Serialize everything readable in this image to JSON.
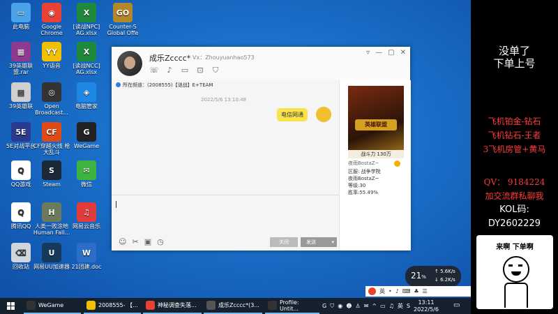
{
  "desktop": {
    "icons": [
      {
        "label": "此电脑",
        "color": "#4aa3e8",
        "glyph": "▭"
      },
      {
        "label": "Google Chrome",
        "color": "#e94235",
        "glyph": "◉"
      },
      {
        "label": "[读战NPC] AG.xlsx",
        "color": "#1f8a3c",
        "glyph": "X"
      },
      {
        "label": "Counter-S Global Offe",
        "color": "#b3872a",
        "glyph": "GO"
      },
      {
        "label": "39英雄联盟.rar",
        "color": "#8e3a8e",
        "glyph": "▦"
      },
      {
        "label": "YY语音",
        "color": "#f2c000",
        "glyph": "YY"
      },
      {
        "label": "[读战NCC] AG.xlsx",
        "color": "#1f8a3c",
        "glyph": "X"
      },
      {
        "label": "39英雄联",
        "color": "#cfcfcf",
        "glyph": "▤"
      },
      {
        "label": "Open Broadcast...",
        "color": "#333333",
        "glyph": "◎"
      },
      {
        "label": "电脑管家",
        "color": "#1e88e5",
        "glyph": "◈"
      },
      {
        "label": "5E对战平台",
        "color": "#2b3a8f",
        "glyph": "5E"
      },
      {
        "label": "CF穿越火线 枪大乱斗",
        "color": "#e04a16",
        "glyph": "CF"
      },
      {
        "label": "WeGame",
        "color": "#222222",
        "glyph": "G"
      },
      {
        "label": "QQ游戏",
        "color": "#ffffff",
        "glyph": "Q"
      },
      {
        "label": "Steam",
        "color": "#1b2838",
        "glyph": "S"
      },
      {
        "label": "微信",
        "color": "#3fb33f",
        "glyph": "✉"
      },
      {
        "label": "腾讯QQ",
        "color": "#ffffff",
        "glyph": "Q"
      },
      {
        "label": "人类一败涂地 Human Fall...",
        "color": "#6b7a5c",
        "glyph": "H"
      },
      {
        "label": "网易云音乐",
        "color": "#e23b3b",
        "glyph": "♫"
      },
      {
        "label": "回收站",
        "color": "#cfd6de",
        "glyph": "⌫"
      },
      {
        "label": "网易UU加速器",
        "color": "#163a5a",
        "glyph": "U"
      },
      {
        "label": "21团建.doc",
        "color": "#2b6dc7",
        "glyph": "W"
      }
    ]
  },
  "chat": {
    "name": "成乐Zcccc*",
    "account": "Vx：Zhouyuanhao573",
    "notice": "所在频道：(2008555)【谜战】E+TEAM",
    "timestamp": "2022/5/6 13:10:48",
    "message": "电信网通",
    "close_label": "关闭",
    "send_label": "发送",
    "side": {
      "power_label": "战斗力 130万",
      "game_logo": "英雄联盟",
      "server_line": "区服: 战争学院",
      "rank_lines": [
        "夜雨BostaZ~",
        "等级:30",
        "胜率:55.49%"
      ],
      "check_label": "✓",
      "server_prefix": "夜雨BostaZ~"
    }
  },
  "netwidget": {
    "percent": "21",
    "percent_unit": "%",
    "up": "5.6K/s",
    "down": "6.2K/s"
  },
  "ime": {
    "lang": "英"
  },
  "taskbar": {
    "items": [
      {
        "label": "WeGame",
        "color": "#333"
      },
      {
        "label": "2008555- 【...",
        "color": "#f2c000"
      },
      {
        "label": "神秘调查失落...",
        "color": "#e94235"
      },
      {
        "label": "成乐Zcccc*(3...",
        "color": "#555"
      },
      {
        "label": "Profile: Untit...",
        "color": "#333"
      }
    ],
    "tray_lang": "英",
    "time": "13:11",
    "date": "2022/5/6"
  },
  "overlay": {
    "head": [
      "没单了",
      "下单上号"
    ],
    "red_lines": [
      "飞机铂金-钻石",
      "飞机钻石-王者",
      "3飞机房管+黄马"
    ],
    "qv": "QV：  9184224",
    "group": "加交流群私聊我",
    "kol": "KOL码:",
    "kol_code": "DY2602229",
    "meme_text": "来啊 下单啊"
  }
}
